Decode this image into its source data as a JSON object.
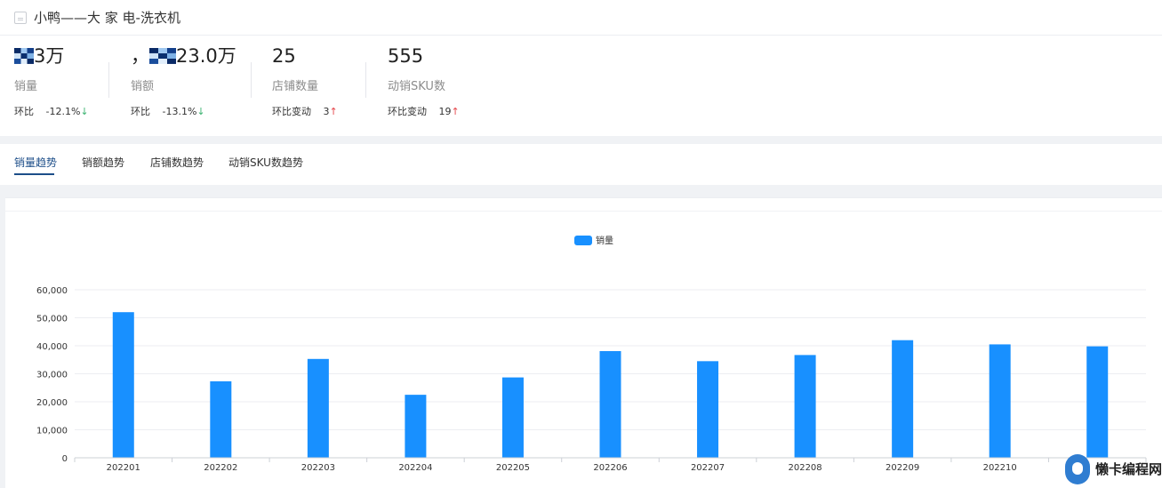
{
  "header": {
    "title": "小鸭——大 家 电-洗衣机"
  },
  "stats": [
    {
      "value_prefix": "",
      "value_suffix": "3万",
      "label": "销量",
      "change_label": "环比",
      "change_value": "-12.1%",
      "direction": "↓"
    },
    {
      "value_prefix": "，",
      "value_suffix": "23.0万",
      "label": "销额",
      "change_label": "环比",
      "change_value": "-13.1%",
      "direction": "↓"
    },
    {
      "value_prefix": "25",
      "value_suffix": "",
      "label": "店铺数量",
      "change_label": "环比变动",
      "change_value": "3",
      "direction": "↑"
    },
    {
      "value_prefix": "555",
      "value_suffix": "",
      "label": "动销SKU数",
      "change_label": "环比变动",
      "change_value": "19",
      "direction": "↑"
    }
  ],
  "tabs": [
    {
      "label": "销量趋势",
      "active": true
    },
    {
      "label": "销额趋势",
      "active": false
    },
    {
      "label": "店铺数趋势",
      "active": false
    },
    {
      "label": "动销SKU数趋势",
      "active": false
    }
  ],
  "watermark": {
    "text": "懒卡编程网"
  },
  "colors": {
    "bar": "#1890ff",
    "accent": "#1d4e89",
    "down": "#3cb371",
    "up": "#e5484d"
  },
  "chart_data": {
    "type": "bar",
    "legend": {
      "position": "top-center",
      "entries": [
        "销量"
      ]
    },
    "categories": [
      "202201",
      "202202",
      "202203",
      "202204",
      "202205",
      "202206",
      "202207",
      "202208",
      "202209",
      "202210",
      "202211"
    ],
    "visible_category_labels": [
      "202201",
      "202202",
      "202203",
      "202204",
      "202205",
      "202206",
      "202207",
      "202208",
      "202209",
      "202210",
      ""
    ],
    "series": [
      {
        "name": "销量",
        "values": [
          52000,
          27300,
          35300,
          22500,
          28700,
          38100,
          34500,
          36700,
          42000,
          40500,
          39800
        ]
      }
    ],
    "ylim": [
      0,
      60000
    ],
    "yticks": [
      0,
      10000,
      20000,
      30000,
      40000,
      50000,
      60000
    ],
    "ytick_labels": [
      "0",
      "10,000",
      "20,000",
      "30,000",
      "40,000",
      "50,000",
      "60,000"
    ],
    "grid": true
  }
}
